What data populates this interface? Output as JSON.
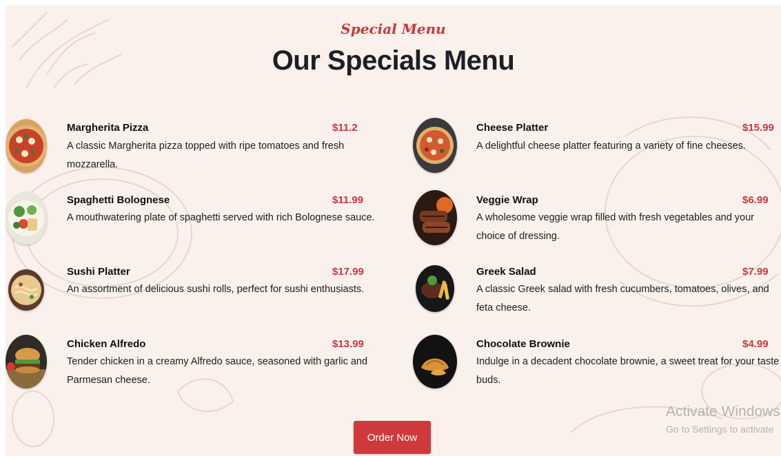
{
  "header": {
    "subtitle": "Special Menu",
    "title": "Our Specials Menu"
  },
  "menu": {
    "left": [
      {
        "name": "Margherita Pizza",
        "price": "$11.2",
        "description": "A classic Margherita pizza topped with ripe tomatoes and fresh mozzarella."
      },
      {
        "name": "Spaghetti Bolognese",
        "price": "$11.99",
        "description": "A mouthwatering plate of spaghetti served with rich Bolognese sauce."
      },
      {
        "name": "Sushi Platter",
        "price": "$17.99",
        "description": "An assortment of delicious sushi rolls, perfect for sushi enthusiasts."
      },
      {
        "name": "Chicken Alfredo",
        "price": "$13.99",
        "description": "Tender chicken in a creamy Alfredo sauce, seasoned with garlic and Parmesan cheese."
      }
    ],
    "right": [
      {
        "name": "Cheese Platter",
        "price": "$15.99",
        "description": "A delightful cheese platter featuring a variety of fine cheeses."
      },
      {
        "name": "Veggie Wrap",
        "price": "$6.99",
        "description": "A wholesome veggie wrap filled with fresh vegetables and your choice of dressing."
      },
      {
        "name": "Greek Salad",
        "price": "$7.99",
        "description": "A classic Greek salad with fresh cucumbers, tomatoes, olives, and feta cheese."
      },
      {
        "name": "Chocolate Brownie",
        "price": "$4.99",
        "description": "Indulge in a decadent chocolate brownie, a sweet treat for your taste buds."
      }
    ]
  },
  "actions": {
    "order_label": "Order Now"
  },
  "watermark": {
    "line1": "Activate Windows",
    "line2": "Go to Settings to activate"
  },
  "colors": {
    "accent": "#c8373c",
    "button": "#d0393b",
    "background": "#fbf1ec",
    "heading": "#1e1e24"
  },
  "icons": {
    "left": [
      "pizza-photo",
      "salad-photo",
      "noodles-photo",
      "burger-photo"
    ],
    "right": [
      "pizza-photo",
      "grilled-meat-photo",
      "steak-fries-photo",
      "croissant-photo"
    ]
  }
}
